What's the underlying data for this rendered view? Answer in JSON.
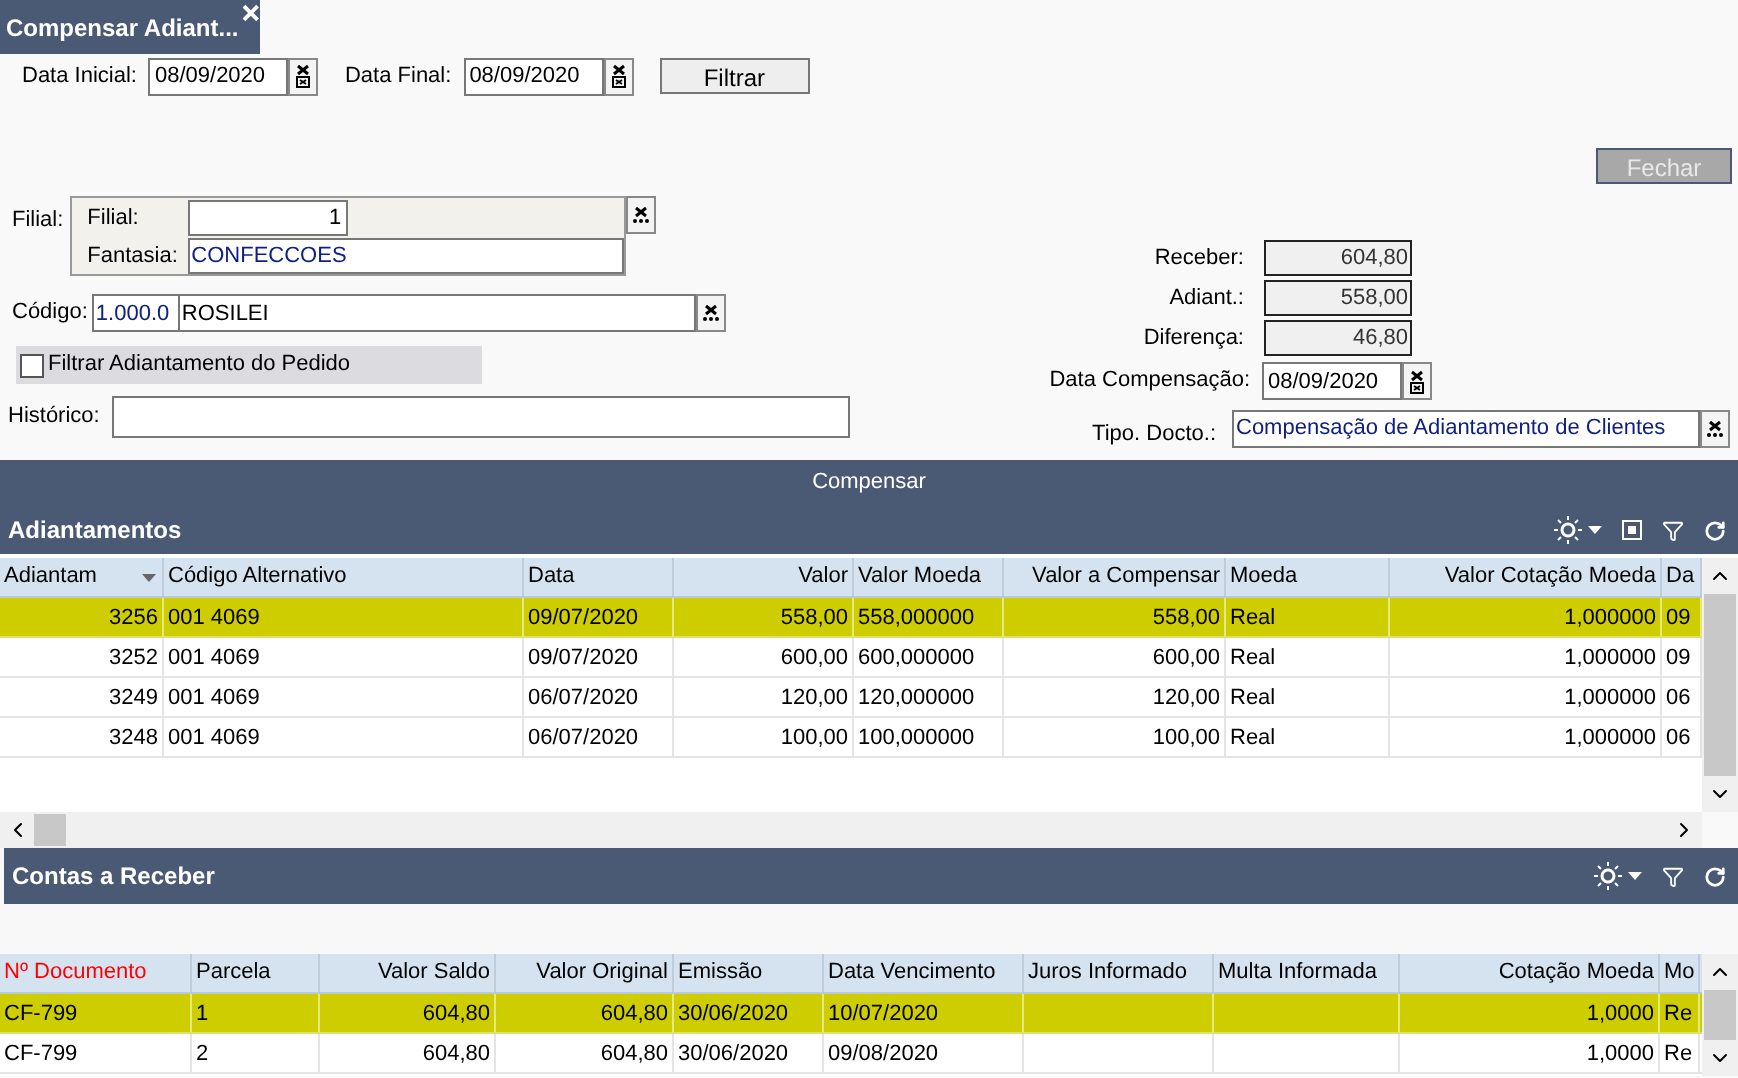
{
  "tab": {
    "title": "Compensar Adiant..."
  },
  "filters": {
    "start": {
      "label": "Data Inicial:",
      "value": "08/09/2020"
    },
    "end": {
      "label": "Data Final:",
      "value": "08/09/2020"
    },
    "button": "Filtrar"
  },
  "close_button": {
    "label": "Fechar",
    "disabled": true
  },
  "filial": {
    "label": "Filial:",
    "inner_label": "Filial:",
    "value": "1",
    "fantasia_label": "Fantasia:",
    "fantasia_value": "CONFECCOES"
  },
  "codigo": {
    "label": "Código:",
    "code": "1.000.0",
    "name": "ROSILEI"
  },
  "checkbox": {
    "label": "Filtrar Adiantamento do Pedido",
    "checked": false
  },
  "historico": {
    "label": "Histórico:"
  },
  "totals": [
    {
      "label": "Receber:",
      "value": "604,80"
    },
    {
      "label": "Adiant.:",
      "value": "558,00"
    },
    {
      "label": "Diferença:",
      "value": "46,80"
    }
  ],
  "data_compensacao": {
    "label": "Data Compensação:",
    "value": "08/09/2020"
  },
  "tipo_docto": {
    "label": "Tipo. Docto.:",
    "value": "Compensação de Adiantamento de Clientes"
  },
  "compensar_bar": "Compensar",
  "adiantamentos": {
    "title": "Adiantamentos",
    "columns": [
      {
        "label": "Adiantam",
        "sorted": true
      },
      {
        "label": "Código Alternativo",
        "sorted": false
      },
      {
        "label": "Data",
        "sorted": false
      },
      {
        "label": "Valor",
        "sorted": false
      },
      {
        "label": "Valor Moeda",
        "sorted": false
      },
      {
        "label": "Valor a Compensar",
        "sorted": false
      },
      {
        "label": "Moeda",
        "sorted": false
      },
      {
        "label": "Valor Cotação Moeda",
        "sorted": false
      },
      {
        "label": "Da",
        "sorted": false
      }
    ],
    "rows": [
      {
        "selected": true,
        "cells": [
          "3256",
          "001  4069",
          "09/07/2020",
          "558,00",
          "558,000000",
          "558,00",
          "Real",
          "1,000000",
          "09"
        ]
      },
      {
        "selected": false,
        "cells": [
          "3252",
          "001  4069",
          "09/07/2020",
          "600,00",
          "600,000000",
          "600,00",
          "Real",
          "1,000000",
          "09"
        ]
      },
      {
        "selected": false,
        "cells": [
          "3249",
          "001  4069",
          "06/07/2020",
          "120,00",
          "120,000000",
          "120,00",
          "Real",
          "1,000000",
          "06"
        ]
      },
      {
        "selected": false,
        "cells": [
          "3248",
          "001  4069",
          "06/07/2020",
          "100,00",
          "100,000000",
          "100,00",
          "Real",
          "1,000000",
          "06"
        ]
      }
    ]
  },
  "contas": {
    "title": "Contas a Receber",
    "columns": [
      {
        "label": "Nº Documento",
        "highlighted": true
      },
      {
        "label": "Parcela",
        "highlighted": false
      },
      {
        "label": "Valor Saldo",
        "highlighted": false
      },
      {
        "label": "Valor Original",
        "highlighted": false
      },
      {
        "label": "Emissão",
        "highlighted": false
      },
      {
        "label": "Data Vencimento",
        "highlighted": false
      },
      {
        "label": "Juros Informado",
        "highlighted": false
      },
      {
        "label": "Multa Informada",
        "highlighted": false
      },
      {
        "label": "Cotação Moeda",
        "highlighted": false
      },
      {
        "label": "Mo",
        "highlighted": false
      }
    ],
    "rows": [
      {
        "selected": true,
        "cells": [
          "CF-799",
          "1",
          "604,80",
          "604,80",
          "30/06/2020",
          "10/07/2020",
          "",
          "",
          "1,0000",
          "Re"
        ]
      },
      {
        "selected": false,
        "cells": [
          "CF-799",
          "2",
          "604,80",
          "604,80",
          "30/06/2020",
          "09/08/2020",
          "",
          "",
          "1,0000",
          "Re"
        ]
      }
    ]
  }
}
